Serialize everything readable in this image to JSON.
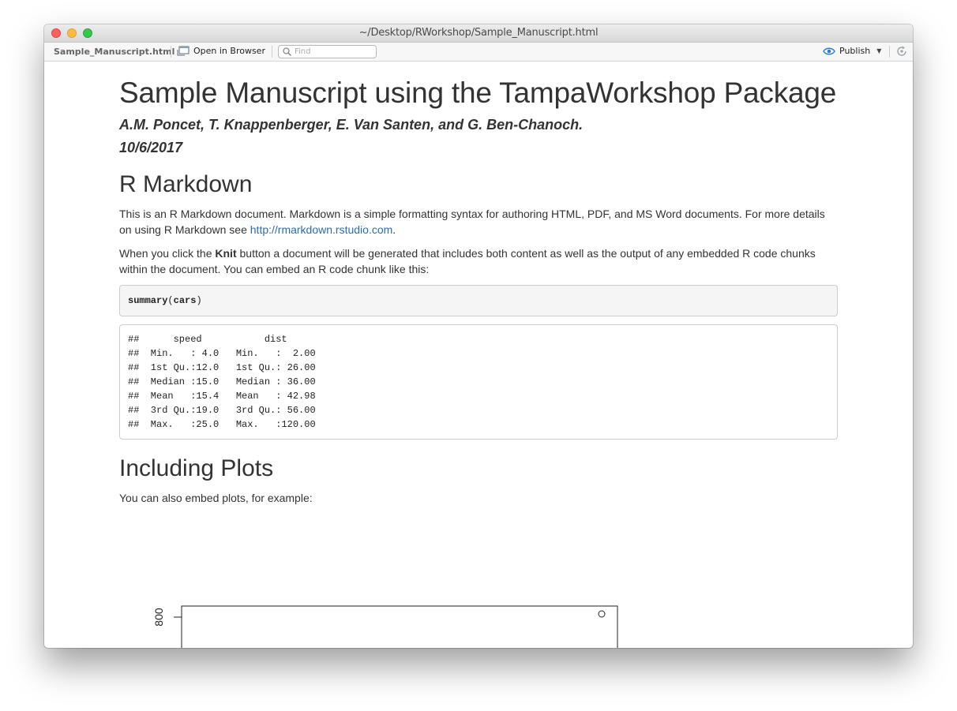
{
  "window": {
    "title": "~/Desktop/RWorkshop/Sample_Manuscript.html"
  },
  "toolbar": {
    "file_label": "Sample_Manuscript.html",
    "open_browser_label": "Open in Browser",
    "find_placeholder": "Find",
    "publish_label": "Publish",
    "icons": {
      "open_browser": "open-in-browser-icon",
      "find": "search-icon",
      "publish": "publish-icon",
      "refresh": "refresh-icon"
    }
  },
  "doc": {
    "title": "Sample Manuscript using the TampaWorkshop Package",
    "authors": "A.M. Poncet, T. Knappenberger, E. Van Santen, and G. Ben-Chanoch.",
    "date": "10/6/2017",
    "section1": {
      "heading": "R Markdown",
      "p1_text": "This is an R Markdown document. Markdown is a simple formatting syntax for authoring HTML, PDF, and MS Word documents. For more details on using R Markdown see ",
      "p1_link": "http://rmarkdown.rstudio.com",
      "p1_end": ".",
      "p2_before": "When you click the ",
      "p2_bold": "Knit",
      "p2_after": " button a document will be generated that includes both content as well as the output of any embedded R code chunks within the document. You can embed an R code chunk like this:",
      "code_fn": "summary",
      "code_open": "(",
      "code_arg": "cars",
      "code_close": ")",
      "output_lines": [
        "##      speed           dist       ",
        "##  Min.   : 4.0   Min.   :  2.00  ",
        "##  1st Qu.:12.0   1st Qu.: 26.00  ",
        "##  Median :15.0   Median : 36.00  ",
        "##  Mean   :15.4   Mean   : 42.98  ",
        "##  3rd Qu.:19.0   3rd Qu.: 56.00  ",
        "##  Max.   :25.0   Max.   :120.00  "
      ]
    },
    "section2": {
      "heading": "Including Plots",
      "p1": "You can also embed plots, for example:"
    },
    "plot": {
      "y_tick_label": "800",
      "points": [
        {
          "x_frac": 0.96,
          "y_value": 800
        }
      ]
    }
  },
  "colors": {
    "link": "#2a6db0",
    "text": "#333333",
    "code_bg": "#f5f5f5",
    "border": "#cccccc"
  }
}
